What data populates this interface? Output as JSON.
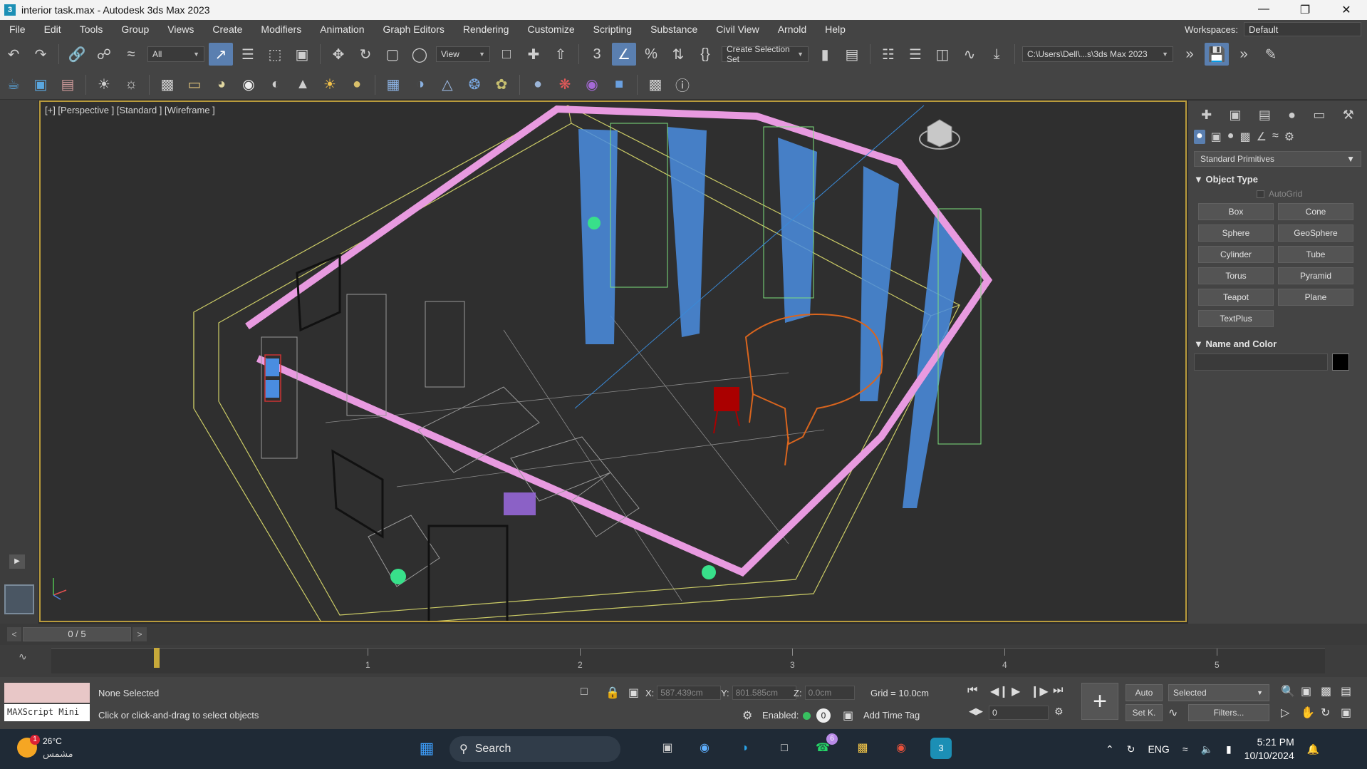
{
  "window": {
    "title": "interior task.max - Autodesk 3ds Max 2023",
    "app_icon": "3"
  },
  "menu": [
    "File",
    "Edit",
    "Tools",
    "Group",
    "Views",
    "Create",
    "Modifiers",
    "Animation",
    "Graph Editors",
    "Rendering",
    "Customize",
    "Scripting",
    "Substance",
    "Civil View",
    "Arnold",
    "Help"
  ],
  "workspaces": {
    "label": "Workspaces:",
    "value": "Default"
  },
  "toolbar": {
    "filter": "All",
    "ref_coord": "View",
    "selection_set": "Create Selection Set",
    "project_path": "C:\\Users\\Dell\\...s\\3ds Max 2023"
  },
  "viewport": {
    "label": "[+] [Perspective ] [Standard ] [Wireframe ]"
  },
  "command_panel": {
    "category": "Standard Primitives",
    "object_type_title": "Object Type",
    "autogrid": "AutoGrid",
    "buttons": [
      "Box",
      "Cone",
      "Sphere",
      "GeoSphere",
      "Cylinder",
      "Tube",
      "Torus",
      "Pyramid",
      "Teapot",
      "Plane",
      "TextPlus"
    ],
    "name_color_title": "Name and Color",
    "color": "#000000"
  },
  "time": {
    "slider": "0 / 5",
    "ticks": [
      "1",
      "2",
      "3",
      "4",
      "5"
    ]
  },
  "status": {
    "maxscript": "MAXScript Mini",
    "selected": "None Selected",
    "prompt": "Click or click-and-drag to select objects",
    "x_label": "X:",
    "x_value": "587.439cm",
    "y_label": "Y:",
    "y_value": "801.585cm",
    "z_label": "Z:",
    "z_value": "0.0cm",
    "grid": "Grid = 10.0cm",
    "enabled": "Enabled:",
    "add_time_tag": "Add Time Tag",
    "auto": "Auto",
    "selected_dd": "Selected",
    "set_key": "Set K.",
    "filters": "Filters...",
    "frame": "0"
  },
  "taskbar": {
    "temp": "26°C",
    "weather": "مشمس",
    "weather_badge": "1",
    "search": "Search",
    "whatsapp_badge": "6",
    "lang": "ENG",
    "time": "5:21 PM",
    "date": "10/10/2024"
  }
}
